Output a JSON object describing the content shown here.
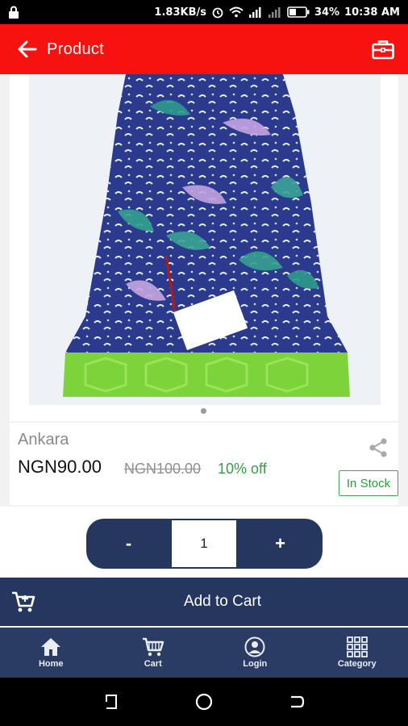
{
  "status_bar": {
    "speed": "1.83KB/s",
    "battery": "34%",
    "time": "10:38 AM"
  },
  "app_bar": {
    "title": "Product"
  },
  "product": {
    "name": "Ankara",
    "price": "NGN90.00",
    "old_price": "NGN100.00",
    "discount": "10% off",
    "stock_status": "In Stock",
    "carousel_index": 1,
    "carousel_count": 1
  },
  "quantity": {
    "minus_label": "-",
    "value": "1",
    "plus_label": "+"
  },
  "add_to_cart": {
    "label": "Add to Cart"
  },
  "bottom_nav": {
    "items": [
      {
        "label": "Home",
        "icon": "home-icon"
      },
      {
        "label": "Cart",
        "icon": "cart-icon"
      },
      {
        "label": "Login",
        "icon": "user-icon"
      },
      {
        "label": "Category",
        "icon": "grid-icon"
      }
    ]
  },
  "colors": {
    "app_bar": "#f7110f",
    "primary_dark": "#25375f",
    "nav": "#2a3c64",
    "discount_green": "#2fa043"
  }
}
